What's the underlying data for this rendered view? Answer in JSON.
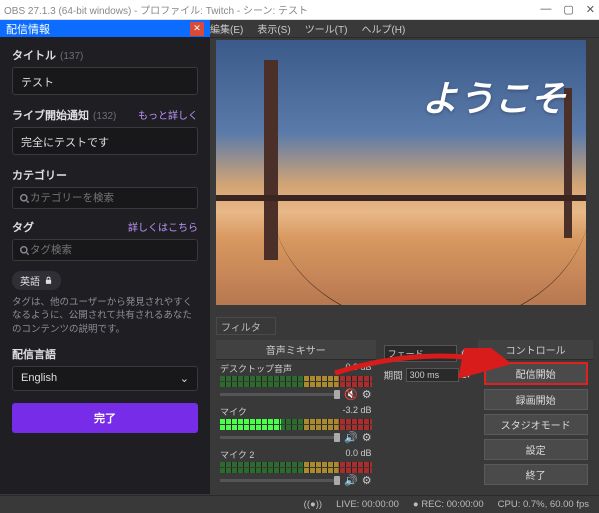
{
  "window": {
    "title": "OBS 27.1.3 (64-bit windows) - プロファイル: Twitch - シーン: テスト"
  },
  "menubar": [
    "編集(E)",
    "表示(S)",
    "ツール(T)",
    "ヘルプ(H)"
  ],
  "panel": {
    "header": "配信情報",
    "title_label": "タイトル",
    "title_count": "(137)",
    "title_value": "テスト",
    "golive_label": "ライブ開始通知",
    "golive_count": "(132)",
    "golive_link": "もっと詳しく",
    "golive_value": "完全にテストです",
    "category_label": "カテゴリー",
    "category_placeholder": "カテゴリーを検索",
    "tags_label": "タグ",
    "tags_link": "詳しくはこちら",
    "tags_placeholder": "タグ検索",
    "lang_chip": "英語",
    "help_text": "タグは、他のユーザーから発見されやすくなるように、公開されて共有されるあなたのコンテンツの説明です。",
    "stream_lang_label": "配信言語",
    "stream_lang_value": "English",
    "done": "完了"
  },
  "preview": {
    "welcome": "ようこそ"
  },
  "filters_label": "フィルタ",
  "mixer": {
    "title": "音声ミキサー",
    "items": [
      {
        "name": "デスクトップ音声",
        "db": "0.0 dB"
      },
      {
        "name": "マイク",
        "db": "-3.2 dB"
      },
      {
        "name": "マイク 2",
        "db": "0.0 dB"
      }
    ]
  },
  "transitions": {
    "fade_label": "フェード",
    "duration_label": "期間",
    "duration_value": "300 ms"
  },
  "controls": {
    "title": "コントロール",
    "buttons": [
      "配信開始",
      "録画開始",
      "スタジオモード",
      "設定",
      "終了"
    ]
  },
  "statusbar": {
    "live": "LIVE: 00:00:00",
    "rec": "REC: 00:00:00",
    "cpu": "CPU: 0.7%, 60.00 fps"
  }
}
